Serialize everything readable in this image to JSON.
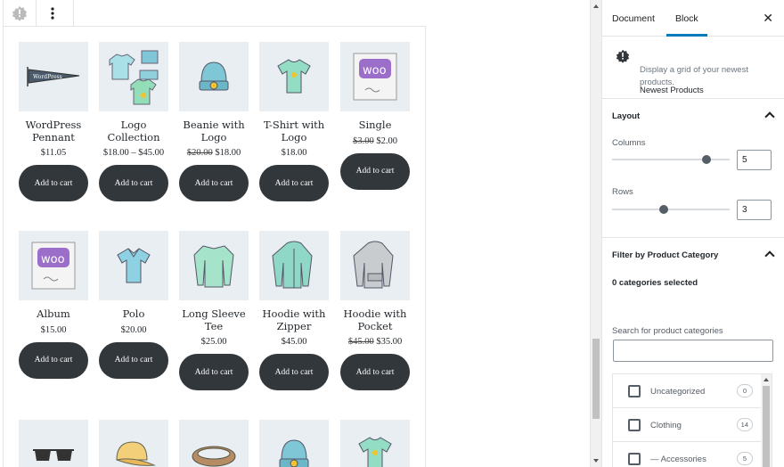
{
  "sidebar": {
    "tabs": [
      {
        "label": "Document",
        "active": false
      },
      {
        "label": "Block",
        "active": true
      }
    ],
    "close_label": "✕",
    "block_card": {
      "title": "Newest Products",
      "description": "Display a grid of your newest products.",
      "icon": "star-burst-icon"
    },
    "layout": {
      "title": "Layout",
      "columns_label": "Columns",
      "columns_value": "5",
      "columns_fraction": 0.8,
      "rows_label": "Rows",
      "rows_value": "3",
      "rows_fraction": 0.44
    },
    "category_filter": {
      "title": "Filter by Product Category",
      "selected_text": "0 categories selected",
      "search_label": "Search for product categories",
      "search_value": "",
      "categories": [
        {
          "name": "Uncategorized",
          "count": "0"
        },
        {
          "name": "Clothing",
          "count": "14"
        },
        {
          "name": "— Accessories",
          "count": "5"
        }
      ]
    }
  },
  "products": [
    {
      "title": "WordPress Pennant",
      "price": "$11.05",
      "old_price": "",
      "cart_label": "Add to cart",
      "icon": "pennant-icon"
    },
    {
      "title": "Logo Collection",
      "price": "$18.00 – $45.00",
      "old_price": "",
      "cart_label": "Add to cart",
      "icon": "clothes-collection-icon"
    },
    {
      "title": "Beanie with Logo",
      "price": "$18.00",
      "old_price": "$20.00",
      "cart_label": "Add to cart",
      "icon": "beanie-icon"
    },
    {
      "title": "T-Shirt with Logo",
      "price": "$18.00",
      "old_price": "",
      "cart_label": "Add to cart",
      "icon": "tshirt-icon"
    },
    {
      "title": "Single",
      "price": "$2.00",
      "old_price": "$3.00",
      "cart_label": "Add to cart",
      "icon": "woo-album-icon"
    },
    {
      "title": "Album",
      "price": "$15.00",
      "old_price": "",
      "cart_label": "Add to cart",
      "icon": "woo-album-icon"
    },
    {
      "title": "Polo",
      "price": "$20.00",
      "old_price": "",
      "cart_label": "Add to cart",
      "icon": "polo-icon"
    },
    {
      "title": "Long Sleeve Tee",
      "price": "$25.00",
      "old_price": "",
      "cart_label": "Add to cart",
      "icon": "long-sleeve-icon"
    },
    {
      "title": "Hoodie with Zipper",
      "price": "$45.00",
      "old_price": "",
      "cart_label": "Add to cart",
      "icon": "hoodie-zipper-icon"
    },
    {
      "title": "Hoodie with Pocket",
      "price": "$35.00",
      "old_price": "$45.00",
      "cart_label": "Add to cart",
      "icon": "hoodie-icon"
    },
    {
      "title": "",
      "price": "",
      "old_price": "",
      "cart_label": "",
      "icon": "sunglasses-icon"
    },
    {
      "title": "",
      "price": "",
      "old_price": "",
      "cart_label": "",
      "icon": "cap-icon"
    },
    {
      "title": "",
      "price": "",
      "old_price": "",
      "cart_label": "",
      "icon": "belt-icon"
    },
    {
      "title": "",
      "price": "",
      "old_price": "",
      "cart_label": "",
      "icon": "beanie-icon"
    },
    {
      "title": "",
      "price": "",
      "old_price": "",
      "cart_label": "",
      "icon": "tshirt-icon"
    }
  ],
  "colors": {
    "button_bg": "#32373c",
    "thumb_bg": "#e8eef1",
    "accent": "#007cba"
  }
}
